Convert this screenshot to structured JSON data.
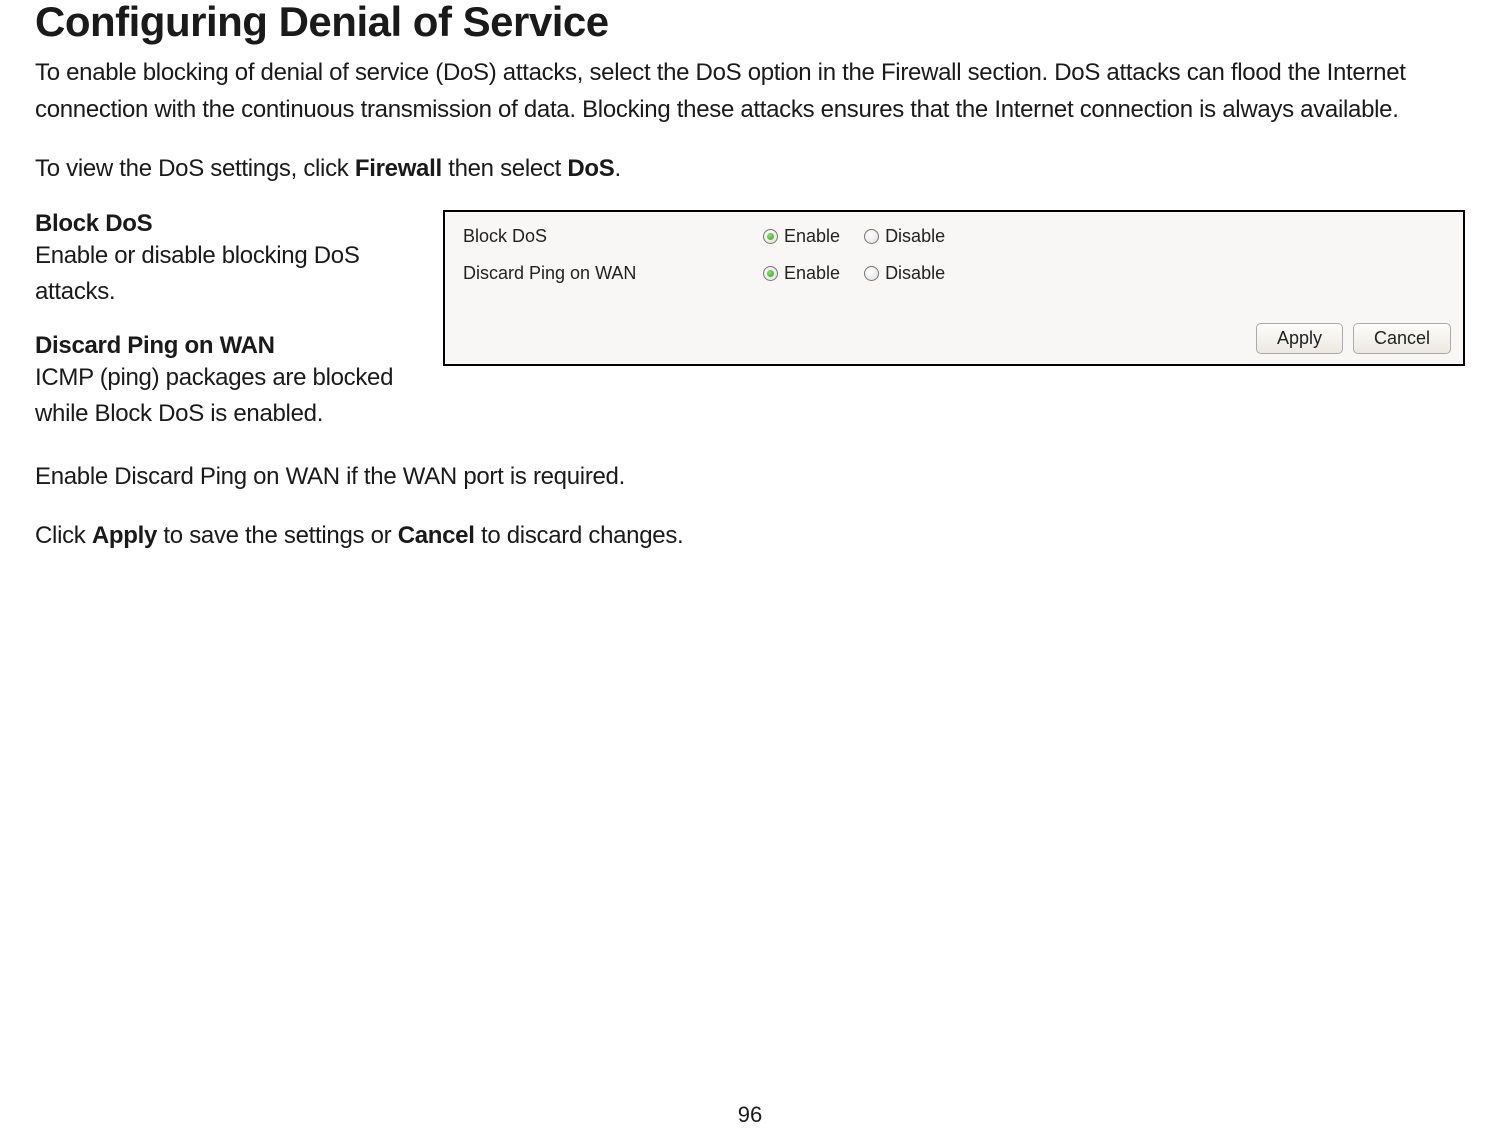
{
  "title": "Configuring Denial of Service",
  "intro": "To enable blocking of denial of service (DoS) attacks, select the DoS option in the Firewall section. DoS attacks can flood the Internet connection with the continuous transmission of data. Blocking these attacks ensures that the Internet connection is always available.",
  "nav_line": {
    "prefix": "To view the DoS settings, click ",
    "firewall": "Firewall",
    "mid": " then select ",
    "dos": "DoS",
    "suffix": "."
  },
  "sections": {
    "block_dos": {
      "head": "Block DoS",
      "desc": "Enable or disable blocking DoS attacks."
    },
    "discard_ping": {
      "head": "Discard Ping on WAN",
      "desc": "ICMP (ping) packages are blocked while Block DoS is enabled."
    }
  },
  "discard_required": "Enable Discard Ping on WAN if the WAN port is required.",
  "apply_line": {
    "p1": "Click ",
    "apply": "Apply",
    "p2": " to save the settings or ",
    "cancel": "Cancel",
    "p3": " to discard changes."
  },
  "panel": {
    "rows": [
      {
        "label": "Block DoS",
        "enable": "Enable",
        "disable": "Disable",
        "selected": "enable"
      },
      {
        "label": "Discard Ping on WAN",
        "enable": "Enable",
        "disable": "Disable",
        "selected": "enable"
      }
    ],
    "buttons": {
      "apply": "Apply",
      "cancel": "Cancel"
    }
  },
  "page_number": "96"
}
